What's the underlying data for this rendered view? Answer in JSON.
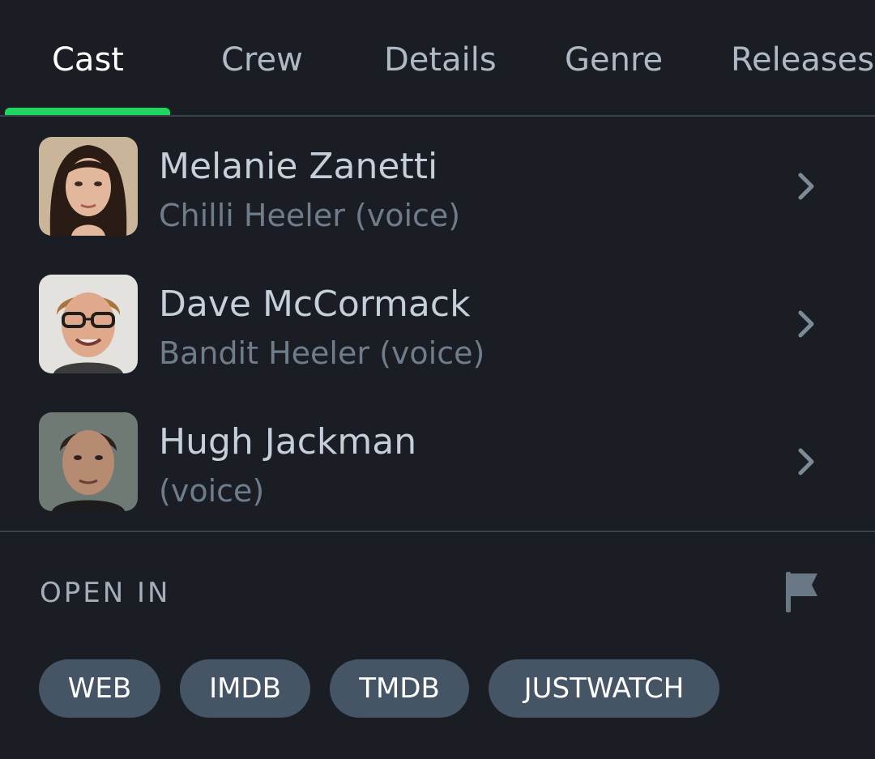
{
  "tabs": {
    "cast": "Cast",
    "crew": "Crew",
    "details": "Details",
    "genre": "Genre",
    "releases": "Releases",
    "active": "Cast"
  },
  "cast": [
    {
      "name": "Melanie Zanetti",
      "role": "Chilli Heeler (voice)"
    },
    {
      "name": "Dave McCormack",
      "role": "Bandit Heeler (voice)"
    },
    {
      "name": "Hugh Jackman",
      "role": "(voice)"
    }
  ],
  "open_in": {
    "label": "OPEN IN",
    "links": {
      "web": "WEB",
      "imdb": "IMDB",
      "tmdb": "TMDB",
      "justwatch": "JUSTWATCH"
    }
  },
  "icons": {
    "chevron": "chevron-right-icon",
    "flag": "flag-icon"
  },
  "colors": {
    "background": "#1a1d23",
    "accent": "#1ed760",
    "chip": "#455566",
    "divider": "#3a444f"
  }
}
